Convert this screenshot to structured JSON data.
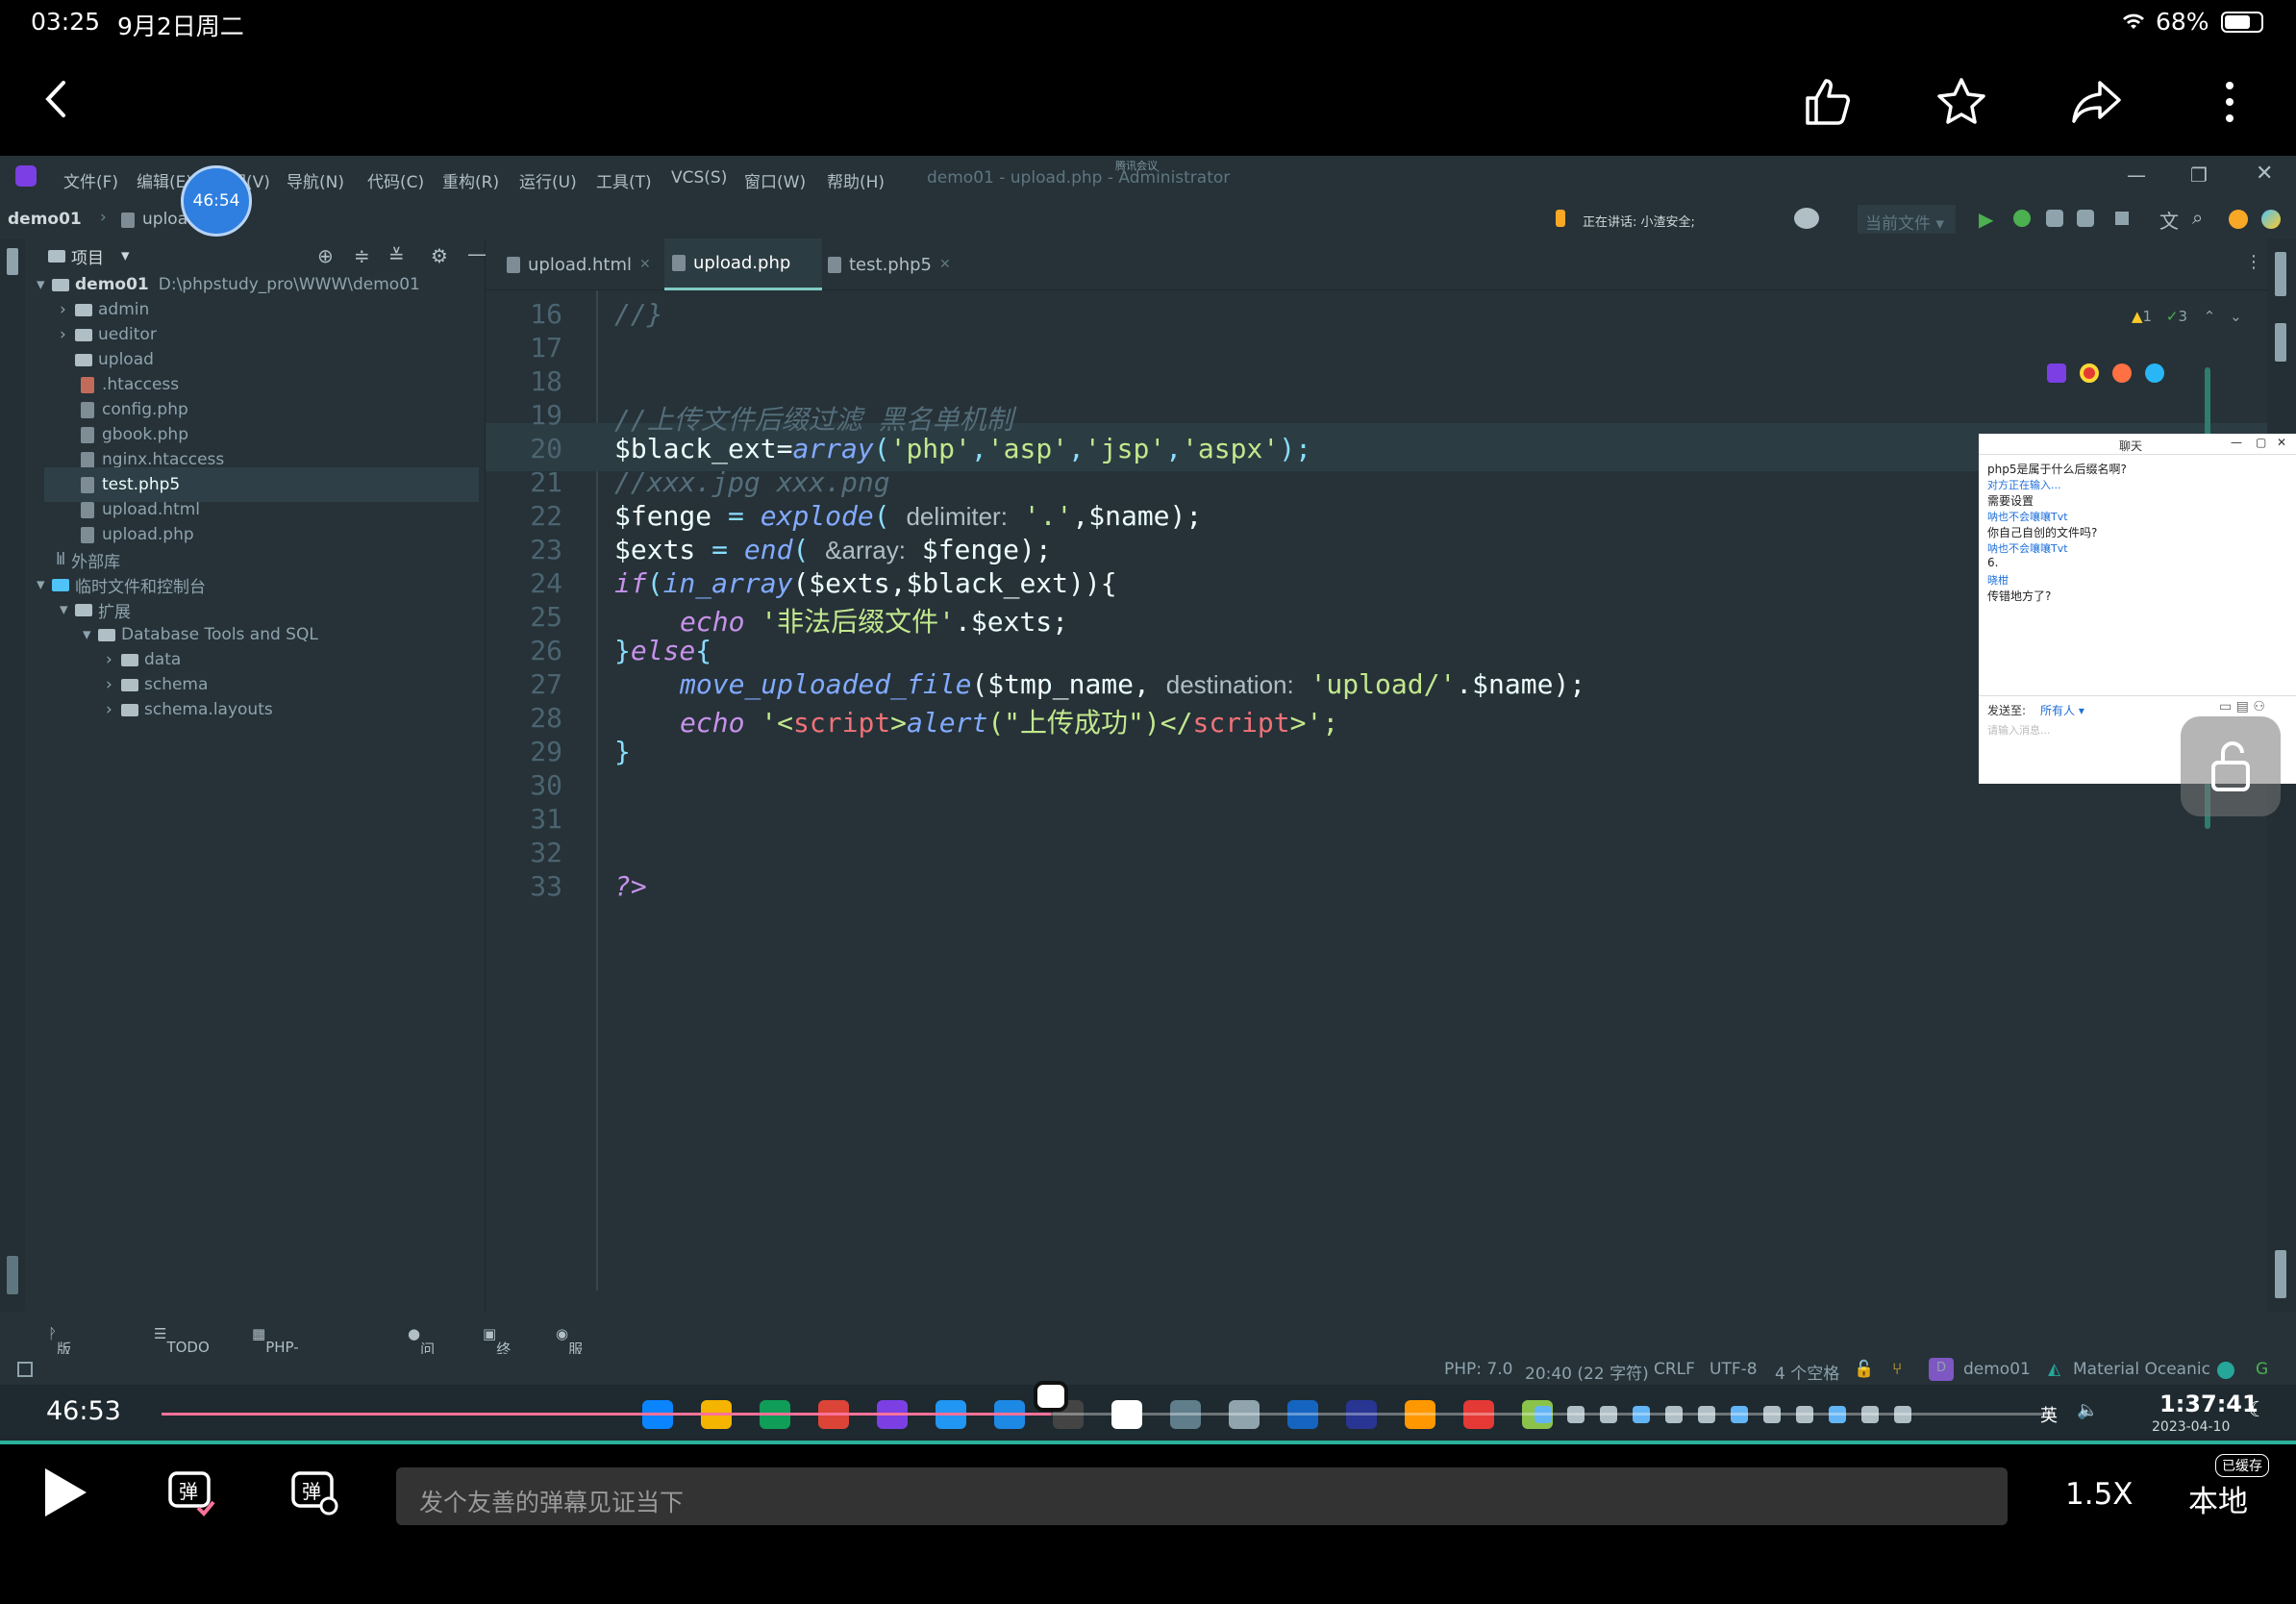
{
  "status": {
    "time": "03:25",
    "date": "9月2日周二",
    "battery": "68%"
  },
  "ide": {
    "menu": [
      "文件(F)",
      "编辑(E)",
      "视图(V)",
      "导航(N)",
      "代码(C)",
      "重构(R)",
      "运行(U)",
      "工具(T)",
      "VCS(S)",
      "窗口(W)",
      "帮助(H)"
    ],
    "window_title": "demo01 - upload.php - Administrator",
    "meeting": "腾讯会议",
    "breadcrumb": {
      "project": "demo01",
      "file": "upload.php"
    },
    "speaking": "正在讲话: 小渣安全;",
    "run_config": "当前文件",
    "project_label": "项目",
    "tree": [
      {
        "label": "demo01",
        "path": "D:\\phpstudy_pro\\WWW\\demo01",
        "type": "folder"
      },
      {
        "label": "admin",
        "type": "folder"
      },
      {
        "label": "ueditor",
        "type": "folder"
      },
      {
        "label": "upload",
        "type": "folder"
      },
      {
        "label": ".htaccess",
        "type": "file"
      },
      {
        "label": "config.php",
        "type": "file"
      },
      {
        "label": "gbook.php",
        "type": "file"
      },
      {
        "label": "nginx.htaccess",
        "type": "file"
      },
      {
        "label": "test.php5",
        "type": "file"
      },
      {
        "label": "upload.html",
        "type": "file"
      },
      {
        "label": "upload.php",
        "type": "file"
      },
      {
        "label": "外部库",
        "type": "lib"
      },
      {
        "label": "临时文件和控制台",
        "type": "folder"
      },
      {
        "label": "扩展",
        "type": "folder"
      },
      {
        "label": "Database Tools and SQL",
        "type": "folder"
      },
      {
        "label": "data",
        "type": "folder"
      },
      {
        "label": "schema",
        "type": "folder"
      },
      {
        "label": "schema.layouts",
        "type": "folder"
      }
    ],
    "tabs": [
      "upload.html",
      "upload.php",
      "test.php5"
    ],
    "inspections": {
      "warnings": "1",
      "ok": "3"
    },
    "line_numbers": [
      "16",
      "17",
      "18",
      "19",
      "20",
      "21",
      "22",
      "23",
      "24",
      "25",
      "26",
      "27",
      "28",
      "29",
      "30",
      "31",
      "32",
      "33"
    ],
    "code": {
      "l16": "//}",
      "l19": "//上传文件后缀过滤 黑名单机制",
      "l20a": "$black_ext=",
      "l20b": "array",
      "l20c": "(",
      "l20d": "'php'",
      "l20e": ",",
      "l20f": "'asp'",
      "l20g": ",",
      "l20h": "'jsp'",
      "l20i": ",",
      "l20j": "'aspx'",
      "l20k": ");",
      "l21": "//xxx.jpg xxx.png",
      "l22a": "$fenge",
      "l22b": " = ",
      "l22c": "explode",
      "l22d": "( ",
      "l22e": "delimiter:",
      "l22f": " '.'",
      "l22g": ",$name);",
      "l23a": "$exts",
      "l23b": " = ",
      "l23c": "end",
      "l23d": "( ",
      "l23e": "&array:",
      "l23f": " $fenge);",
      "l24a": "if",
      "l24b": "(",
      "l24c": "in_array",
      "l24d": "($exts,$black_ext)){",
      "l25a": "echo",
      "l25b": " '非法后缀文件'",
      "l25c": ".$exts;",
      "l26a": "}",
      "l26b": "else",
      "l26c": "{",
      "l27a": "move_uploaded_file",
      "l27b": "($tmp_name, ",
      "l27c": "destination:",
      "l27d": " 'upload/'",
      "l27e": ".$name);",
      "l28a": "echo",
      "l28b": " '<",
      "l28c": "script",
      "l28d": ">",
      "l28e": "alert",
      "l28f": "(\"上传成功\")</",
      "l28g": "script",
      "l28h": ">';",
      "l29": "}",
      "l33": "?>"
    },
    "tools": [
      "版本控制",
      "TODO",
      "PHP-CGI Server",
      "问题",
      "终端",
      "服务"
    ],
    "statusbar": {
      "php": "PHP: 7.0",
      "position": "20:40 (22 字符)",
      "line_sep": "CRLF",
      "encoding": "UTF-8",
      "indent": "4 个空格",
      "project": "demo01",
      "theme": "Material Oceanic"
    }
  },
  "chat": {
    "title": "聊天",
    "messages": [
      {
        "text": "php5是属于什么后缀名啊?",
        "kind": "msg"
      },
      {
        "text": "对方正在输入...",
        "kind": "name"
      },
      {
        "text": "需要设置",
        "kind": "msg"
      },
      {
        "text": "呐也不会嚷嚷Tvt",
        "kind": "name"
      },
      {
        "text": "你自己自创的文件吗?",
        "kind": "msg"
      },
      {
        "text": "呐也不会嚷嚷Tvt",
        "kind": "name"
      },
      {
        "text": "6.",
        "kind": "msg"
      },
      {
        "text": "晓柑",
        "kind": "name"
      },
      {
        "text": "传错地方了?",
        "kind": "msg"
      }
    ],
    "send_to_label": "发送至:",
    "send_to_value": "所有人",
    "input_placeholder": "请输入消息..."
  },
  "taskbar": {
    "clock": "1:37:41",
    "date": "2023-04-10",
    "ime": "英"
  },
  "player": {
    "current": "46:53",
    "overlay_time": "46:54",
    "progress": 0.47,
    "speed": "1.5X",
    "local": "本地",
    "cached": "已缓存",
    "danmu_placeholder": "发个友善的弹幕见证当下"
  },
  "colors": {
    "progress": "#fb7299",
    "editor_bg": "#263238",
    "accent": "#80cbc4"
  }
}
